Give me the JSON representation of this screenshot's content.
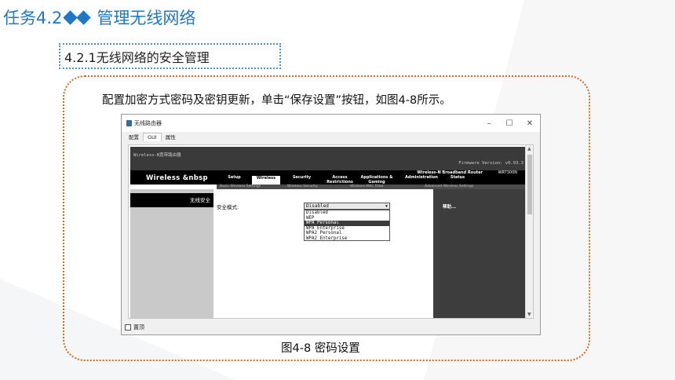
{
  "slide": {
    "title_prefix": "任务4.2",
    "title_suffix": "管理无线网络",
    "section": "4.2.1无线网络的安全管理",
    "description": "配置加密方式密码及密钥更新，单击“保存设置”按钮，如图4-8所示。",
    "caption": "图4-8 密码设置"
  },
  "window": {
    "title": "无线路由器",
    "controls": {
      "minimize": "–",
      "maximize": "☐",
      "close": "✕"
    },
    "tabs": [
      "配置",
      "GUI",
      "属性"
    ],
    "active_tab": "GUI",
    "status_checkbox_label": "置顶"
  },
  "router_page": {
    "brand_line": "Wireless-N宽带路由器",
    "firmware": "Firmware Version: v0.93.3",
    "product": "Wireless &nbsp",
    "router_name": "Wireless-N Broadband Router",
    "model": "WRT300N",
    "nav": [
      {
        "label": "Setup",
        "active": false
      },
      {
        "label": "Wireless",
        "active": true
      },
      {
        "label": "Security",
        "active": false
      },
      {
        "label": "Access Restrictions",
        "active": false
      },
      {
        "label": "Applications & Gaming",
        "active": false
      },
      {
        "label": "Administration",
        "active": false
      },
      {
        "label": "Status",
        "active": false
      }
    ],
    "subnav": [
      "Basic Wireless Settings",
      "Wireless Security",
      "Wireless MAC Filter",
      "Advanced Wireless Settings"
    ],
    "section_title": "无线安全",
    "field_label": "安全模式:",
    "help_label": "帮助...",
    "security_mode": {
      "selected": "Disabled",
      "options": [
        "Disabled",
        "WEP",
        "WPA Personal",
        "WPA Enterprise",
        "WPA2 Personal",
        "WPA2 Enterprise"
      ],
      "highlighted": "WPA Personal"
    }
  },
  "colors": {
    "title_blue": "#1e77c7",
    "frame_orange": "#d56a1f",
    "section_border": "#4a90c9"
  }
}
